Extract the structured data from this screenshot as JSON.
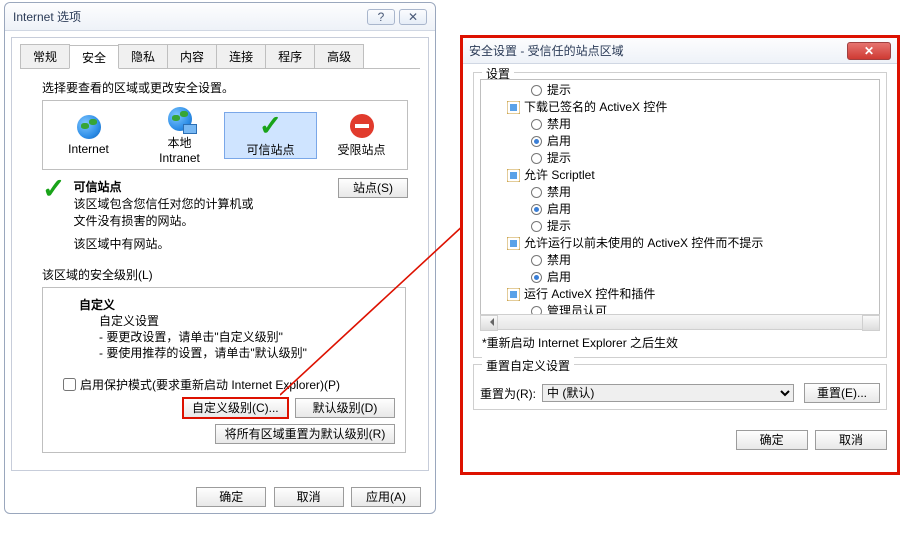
{
  "left": {
    "window_title": "Internet 选项",
    "help_btn": "?",
    "close_btn": "✕",
    "tabs": [
      "常规",
      "安全",
      "隐私",
      "内容",
      "连接",
      "程序",
      "高级"
    ],
    "active_tab_index": 1,
    "zone_prompt": "选择要查看的区域或更改安全设置。",
    "zones": [
      {
        "label": "Internet",
        "sub": ""
      },
      {
        "label": "本地",
        "sub": "Intranet"
      },
      {
        "label": "可信站点",
        "sub": ""
      },
      {
        "label": "受限站点",
        "sub": ""
      }
    ],
    "selected_zone_index": 2,
    "sites_button": "站点(S)",
    "trusted_title": "可信站点",
    "trusted_desc1": "该区域包含您信任对您的计算机或",
    "trusted_desc2": "文件没有损害的网站。",
    "trusted_desc3": "该区域中有网站。",
    "sec_level_caption": "该区域的安全级别(L)",
    "custom_title": "自定义",
    "custom_line1": "自定义设置",
    "custom_line2": "- 要更改设置，请单击\"自定义级别\"",
    "custom_line3": "- 要使用推荐的设置，请单击\"默认级别\"",
    "protected_mode_label": "启用保护模式(要求重新启动 Internet Explorer)(P)",
    "btn_custom_level": "自定义级别(C)...",
    "btn_default_level": "默认级别(D)",
    "btn_reset_all": "将所有区域重置为默认级别(R)",
    "btn_ok": "确定",
    "btn_cancel": "取消",
    "btn_apply": "应用(A)"
  },
  "right": {
    "window_title": "安全设置 - 受信任的站点区域",
    "group_settings": "设置",
    "tree": [
      {
        "type": "option",
        "label": "提示",
        "selected": false
      },
      {
        "type": "node",
        "label": "下载已签名的 ActiveX 控件"
      },
      {
        "type": "option",
        "label": "禁用",
        "selected": false
      },
      {
        "type": "option",
        "label": "启用",
        "selected": true
      },
      {
        "type": "option",
        "label": "提示",
        "selected": false
      },
      {
        "type": "node",
        "label": "允许 Scriptlet"
      },
      {
        "type": "option",
        "label": "禁用",
        "selected": false
      },
      {
        "type": "option",
        "label": "启用",
        "selected": true
      },
      {
        "type": "option",
        "label": "提示",
        "selected": false
      },
      {
        "type": "node",
        "label": "允许运行以前未使用的 ActiveX 控件而不提示"
      },
      {
        "type": "option",
        "label": "禁用",
        "selected": false
      },
      {
        "type": "option",
        "label": "启用",
        "selected": true
      },
      {
        "type": "node",
        "label": "运行 ActiveX 控件和插件"
      },
      {
        "type": "option",
        "label": "管理员认可",
        "selected": false
      }
    ],
    "restart_note": "*重新启动 Internet Explorer 之后生效",
    "group_reset": "重置自定义设置",
    "reset_to_label": "重置为(R):",
    "reset_to_value": "中 (默认)",
    "btn_reset": "重置(E)...",
    "btn_ok": "确定",
    "btn_cancel": "取消"
  }
}
